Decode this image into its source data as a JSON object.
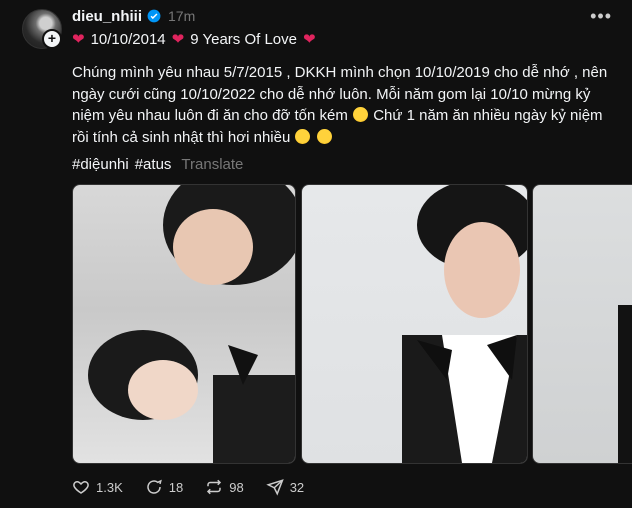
{
  "post": {
    "username": "dieu_nhiii",
    "time": "17m",
    "line1": [
      "10/10/2014",
      "9 Years Of Love"
    ],
    "body_lines": [
      "Chúng mình yêu nhau 5/7/2015 , DKKH mình chọn 10/10/2019 cho dễ nhớ , nên",
      "ngày cưới cũng 10/10/2022 cho dễ nhớ luôn. Mỗi năm gom lại 10/10 mừng kỷ",
      "niệm yêu nhau luôn đi ăn cho đỡ tốn kém",
      "Chứ 1 năm ăn nhiều ngày kỷ niệm",
      "rồi tính cả sinh nhật thì hơi nhiều"
    ],
    "tags": [
      "#diệunhi",
      "#atus"
    ],
    "translate": "Translate"
  },
  "actions": {
    "likes": "1.3K",
    "comments": "18",
    "reposts": "98",
    "shares": "32"
  },
  "colors": {
    "accent": "#e0245e",
    "verified": "#0095f6"
  }
}
